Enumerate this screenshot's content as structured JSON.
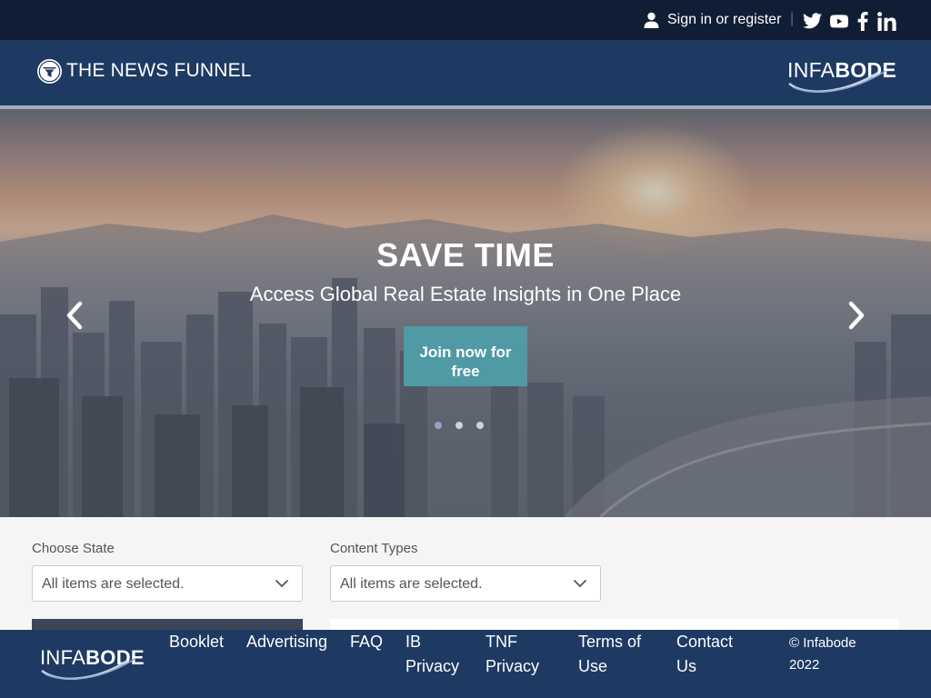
{
  "topbar": {
    "signin_label": "Sign in or register",
    "separator": "|",
    "social_icons": [
      "twitter-icon",
      "youtube-icon",
      "facebook-icon",
      "linkedin-icon"
    ]
  },
  "header": {
    "site_name": "THE NEWS FUNNEL",
    "partner_logo": {
      "light": "INFA",
      "bold": "BODE"
    }
  },
  "hero": {
    "title": "SAVE TIME",
    "subtitle": "Access Global Real Estate Insights in One Place",
    "cta_line1": "Join now for",
    "cta_line2": "free",
    "slides": 3,
    "active_slide": 1
  },
  "filters": {
    "state": {
      "label": "Choose State",
      "value": "All items are selected."
    },
    "content_types": {
      "label": "Content Types",
      "value": "All items are selected."
    }
  },
  "footer": {
    "logo": {
      "light": "INFA",
      "bold": "BODE"
    },
    "links": [
      {
        "line1": "Booklet",
        "line2": ""
      },
      {
        "line1": "Advertising",
        "line2": ""
      },
      {
        "line1": "FAQ",
        "line2": ""
      },
      {
        "line1": "IB",
        "line2": "Privacy"
      },
      {
        "line1": "TNF",
        "line2": "Privacy"
      },
      {
        "line1": "Terms of",
        "line2": "Use"
      },
      {
        "line1": "Contact",
        "line2": "Us"
      }
    ],
    "copyright_line1": "© Infabode",
    "copyright_line2": "2022"
  },
  "colors": {
    "topbar": "#101e35",
    "header": "#1e3a63",
    "cta": "#4f9aa5",
    "page_bg": "#f5f5f5"
  }
}
